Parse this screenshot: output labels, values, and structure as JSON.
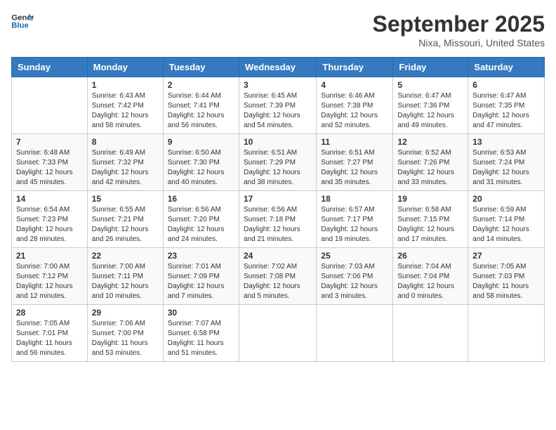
{
  "logo": {
    "text_general": "General",
    "text_blue": "Blue"
  },
  "header": {
    "month": "September 2025",
    "location": "Nixa, Missouri, United States"
  },
  "weekdays": [
    "Sunday",
    "Monday",
    "Tuesday",
    "Wednesday",
    "Thursday",
    "Friday",
    "Saturday"
  ],
  "weeks": [
    [
      {
        "day": "",
        "sunrise": "",
        "sunset": "",
        "daylight": ""
      },
      {
        "day": "1",
        "sunrise": "Sunrise: 6:43 AM",
        "sunset": "Sunset: 7:42 PM",
        "daylight": "Daylight: 12 hours and 58 minutes."
      },
      {
        "day": "2",
        "sunrise": "Sunrise: 6:44 AM",
        "sunset": "Sunset: 7:41 PM",
        "daylight": "Daylight: 12 hours and 56 minutes."
      },
      {
        "day": "3",
        "sunrise": "Sunrise: 6:45 AM",
        "sunset": "Sunset: 7:39 PM",
        "daylight": "Daylight: 12 hours and 54 minutes."
      },
      {
        "day": "4",
        "sunrise": "Sunrise: 6:46 AM",
        "sunset": "Sunset: 7:38 PM",
        "daylight": "Daylight: 12 hours and 52 minutes."
      },
      {
        "day": "5",
        "sunrise": "Sunrise: 6:47 AM",
        "sunset": "Sunset: 7:36 PM",
        "daylight": "Daylight: 12 hours and 49 minutes."
      },
      {
        "day": "6",
        "sunrise": "Sunrise: 6:47 AM",
        "sunset": "Sunset: 7:35 PM",
        "daylight": "Daylight: 12 hours and 47 minutes."
      }
    ],
    [
      {
        "day": "7",
        "sunrise": "Sunrise: 6:48 AM",
        "sunset": "Sunset: 7:33 PM",
        "daylight": "Daylight: 12 hours and 45 minutes."
      },
      {
        "day": "8",
        "sunrise": "Sunrise: 6:49 AM",
        "sunset": "Sunset: 7:32 PM",
        "daylight": "Daylight: 12 hours and 42 minutes."
      },
      {
        "day": "9",
        "sunrise": "Sunrise: 6:50 AM",
        "sunset": "Sunset: 7:30 PM",
        "daylight": "Daylight: 12 hours and 40 minutes."
      },
      {
        "day": "10",
        "sunrise": "Sunrise: 6:51 AM",
        "sunset": "Sunset: 7:29 PM",
        "daylight": "Daylight: 12 hours and 38 minutes."
      },
      {
        "day": "11",
        "sunrise": "Sunrise: 6:51 AM",
        "sunset": "Sunset: 7:27 PM",
        "daylight": "Daylight: 12 hours and 35 minutes."
      },
      {
        "day": "12",
        "sunrise": "Sunrise: 6:52 AM",
        "sunset": "Sunset: 7:26 PM",
        "daylight": "Daylight: 12 hours and 33 minutes."
      },
      {
        "day": "13",
        "sunrise": "Sunrise: 6:53 AM",
        "sunset": "Sunset: 7:24 PM",
        "daylight": "Daylight: 12 hours and 31 minutes."
      }
    ],
    [
      {
        "day": "14",
        "sunrise": "Sunrise: 6:54 AM",
        "sunset": "Sunset: 7:23 PM",
        "daylight": "Daylight: 12 hours and 28 minutes."
      },
      {
        "day": "15",
        "sunrise": "Sunrise: 6:55 AM",
        "sunset": "Sunset: 7:21 PM",
        "daylight": "Daylight: 12 hours and 26 minutes."
      },
      {
        "day": "16",
        "sunrise": "Sunrise: 6:56 AM",
        "sunset": "Sunset: 7:20 PM",
        "daylight": "Daylight: 12 hours and 24 minutes."
      },
      {
        "day": "17",
        "sunrise": "Sunrise: 6:56 AM",
        "sunset": "Sunset: 7:18 PM",
        "daylight": "Daylight: 12 hours and 21 minutes."
      },
      {
        "day": "18",
        "sunrise": "Sunrise: 6:57 AM",
        "sunset": "Sunset: 7:17 PM",
        "daylight": "Daylight: 12 hours and 19 minutes."
      },
      {
        "day": "19",
        "sunrise": "Sunrise: 6:58 AM",
        "sunset": "Sunset: 7:15 PM",
        "daylight": "Daylight: 12 hours and 17 minutes."
      },
      {
        "day": "20",
        "sunrise": "Sunrise: 6:59 AM",
        "sunset": "Sunset: 7:14 PM",
        "daylight": "Daylight: 12 hours and 14 minutes."
      }
    ],
    [
      {
        "day": "21",
        "sunrise": "Sunrise: 7:00 AM",
        "sunset": "Sunset: 7:12 PM",
        "daylight": "Daylight: 12 hours and 12 minutes."
      },
      {
        "day": "22",
        "sunrise": "Sunrise: 7:00 AM",
        "sunset": "Sunset: 7:11 PM",
        "daylight": "Daylight: 12 hours and 10 minutes."
      },
      {
        "day": "23",
        "sunrise": "Sunrise: 7:01 AM",
        "sunset": "Sunset: 7:09 PM",
        "daylight": "Daylight: 12 hours and 7 minutes."
      },
      {
        "day": "24",
        "sunrise": "Sunrise: 7:02 AM",
        "sunset": "Sunset: 7:08 PM",
        "daylight": "Daylight: 12 hours and 5 minutes."
      },
      {
        "day": "25",
        "sunrise": "Sunrise: 7:03 AM",
        "sunset": "Sunset: 7:06 PM",
        "daylight": "Daylight: 12 hours and 3 minutes."
      },
      {
        "day": "26",
        "sunrise": "Sunrise: 7:04 AM",
        "sunset": "Sunset: 7:04 PM",
        "daylight": "Daylight: 12 hours and 0 minutes."
      },
      {
        "day": "27",
        "sunrise": "Sunrise: 7:05 AM",
        "sunset": "Sunset: 7:03 PM",
        "daylight": "Daylight: 11 hours and 58 minutes."
      }
    ],
    [
      {
        "day": "28",
        "sunrise": "Sunrise: 7:05 AM",
        "sunset": "Sunset: 7:01 PM",
        "daylight": "Daylight: 11 hours and 56 minutes."
      },
      {
        "day": "29",
        "sunrise": "Sunrise: 7:06 AM",
        "sunset": "Sunset: 7:00 PM",
        "daylight": "Daylight: 11 hours and 53 minutes."
      },
      {
        "day": "30",
        "sunrise": "Sunrise: 7:07 AM",
        "sunset": "Sunset: 6:58 PM",
        "daylight": "Daylight: 11 hours and 51 minutes."
      },
      {
        "day": "",
        "sunrise": "",
        "sunset": "",
        "daylight": ""
      },
      {
        "day": "",
        "sunrise": "",
        "sunset": "",
        "daylight": ""
      },
      {
        "day": "",
        "sunrise": "",
        "sunset": "",
        "daylight": ""
      },
      {
        "day": "",
        "sunrise": "",
        "sunset": "",
        "daylight": ""
      }
    ]
  ]
}
